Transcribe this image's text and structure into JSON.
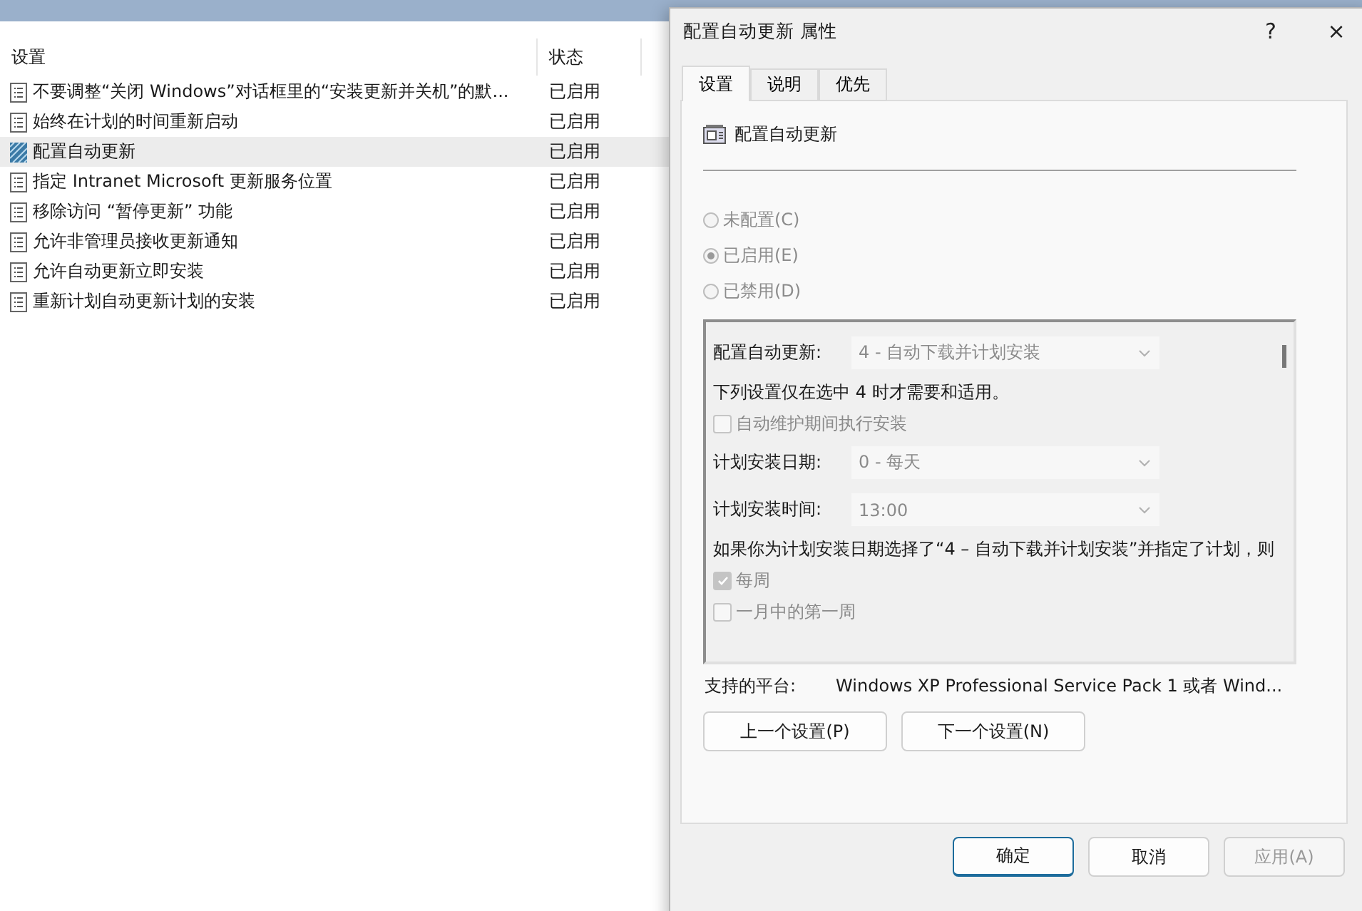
{
  "list": {
    "columns": [
      "设置",
      "状态"
    ],
    "rows": [
      {
        "name": "不要调整“关闭 Windows”对话框里的“安装更新并关机”的默...",
        "status": "已启用",
        "selected": false
      },
      {
        "name": "始终在计划的时间重新启动",
        "status": "已启用",
        "selected": false
      },
      {
        "name": "配置自动更新",
        "status": "已启用",
        "selected": true
      },
      {
        "name": "指定 Intranet Microsoft 更新服务位置",
        "status": "已启用",
        "selected": false
      },
      {
        "name": "移除访问 “暂停更新” 功能",
        "status": "已启用",
        "selected": false
      },
      {
        "name": "允许非管理员接收更新通知",
        "status": "已启用",
        "selected": false
      },
      {
        "name": "允许自动更新立即安装",
        "status": "已启用",
        "selected": false
      },
      {
        "name": "重新计划自动更新计划的安装",
        "status": "已启用",
        "selected": false
      }
    ]
  },
  "dialog": {
    "title": "配置自动更新 属性",
    "help": "?",
    "close": "×",
    "tabs": [
      {
        "label": "设置",
        "selected": true
      },
      {
        "label": "说明",
        "selected": false
      },
      {
        "label": "优先",
        "selected": false
      }
    ],
    "policy_name": "配置自动更新",
    "radios": [
      {
        "label": "未配置(C)",
        "selected": false
      },
      {
        "label": "已启用(E)",
        "selected": true
      },
      {
        "label": "已禁用(D)",
        "selected": false
      }
    ],
    "options": [
      {
        "kind": "select",
        "label": "配置自动更新:",
        "value": "4 - 自动下载并计划安装"
      },
      {
        "kind": "text",
        "label": "下列设置仅在选中 4 时才需要和适用。"
      },
      {
        "kind": "checkbox",
        "label": "自动维护期间执行安装",
        "checked": false
      },
      {
        "kind": "select",
        "label": "计划安装日期:",
        "value": "0 - 每天"
      },
      {
        "kind": "select",
        "label": "计划安装时间:",
        "value": "13:00"
      },
      {
        "kind": "text",
        "label": "如果你为计划安装日期选择了“4 – 自动下载并计划安装”并指定了计划，则"
      },
      {
        "kind": "checkbox",
        "label": "每周",
        "checked": true
      },
      {
        "kind": "checkbox",
        "label": "一月中的第一周",
        "checked": false
      }
    ],
    "platform_label": "支持的平台:",
    "platform": "Windows XP Professional Service Pack 1 或者 Wind...",
    "nav_buttons": [
      "上一个设置(P)",
      "下一个设置(N)"
    ],
    "buttons": [
      {
        "label": "确定",
        "disabled": false
      },
      {
        "label": "取消",
        "disabled": false
      },
      {
        "label": "应用(A)",
        "disabled": true
      }
    ]
  }
}
